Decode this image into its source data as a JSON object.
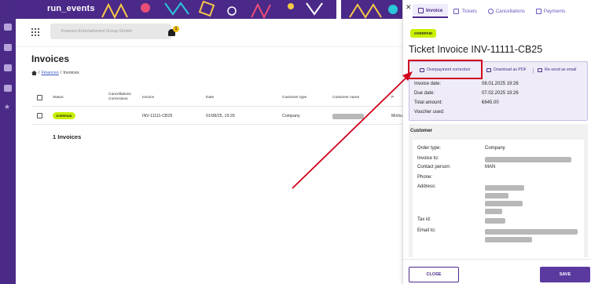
{
  "app": {
    "logo_text": "run_events"
  },
  "header": {
    "org_name": "Kosmos Entertainment Group GmbH",
    "notification_count": "1"
  },
  "page": {
    "title": "Invoices",
    "breadcrumb": {
      "finances": "Finances",
      "separator": " / ",
      "current": "Invoices"
    }
  },
  "table": {
    "columns": {
      "status": "Status",
      "cancellations": "Cancellations",
      "corrections": "Corrections",
      "invoice": "Invoice",
      "date": "Date",
      "customer_type": "Customer type",
      "customer_name": "Customer name",
      "extra": "P"
    },
    "row": {
      "status": "OVERPAID",
      "invoice": "INV-11111-CB25",
      "date": "01/08/25, 19:26",
      "customer_type": "Company",
      "extra": "Michu"
    },
    "count_label": "1 Invoices"
  },
  "panel": {
    "close_symbol": "✕",
    "tabs": [
      "Invoice",
      "Tickets",
      "Cancellations",
      "Payments"
    ],
    "status_badge": "OVERPAID",
    "title": "Ticket Invoice INV-11111-CB25",
    "actions": {
      "overpayment": "Overpayment correction",
      "download": "Download as PDF",
      "resend": "Re-send as email"
    },
    "details": [
      {
        "label": "Invoice date:",
        "value": "08.01.2025 19:26"
      },
      {
        "label": "Due date:",
        "value": "07.02.2025 19:26"
      },
      {
        "label": "Total amount:",
        "value": "€645.00"
      },
      {
        "label": "Voucher used:",
        "value": ""
      }
    ],
    "customer": {
      "section_title": "Customer",
      "fields": [
        {
          "label": "Order type:",
          "value": "Company"
        },
        {
          "label": "Invoice to:",
          "value": ""
        },
        {
          "label": "Contact person:",
          "value": "MAN"
        },
        {
          "label": "Phone:",
          "value": ""
        },
        {
          "label": "Address:",
          "value": ""
        },
        {
          "label": "Tax id:",
          "value": ""
        },
        {
          "label": "Email to:",
          "value": ""
        }
      ]
    },
    "buttons": {
      "close": "CLOSE",
      "save": "SAVE"
    }
  },
  "colors": {
    "brand_purple": "#4b2989",
    "badge_lime": "#c8f000",
    "annotation_red": "#d0021b"
  }
}
